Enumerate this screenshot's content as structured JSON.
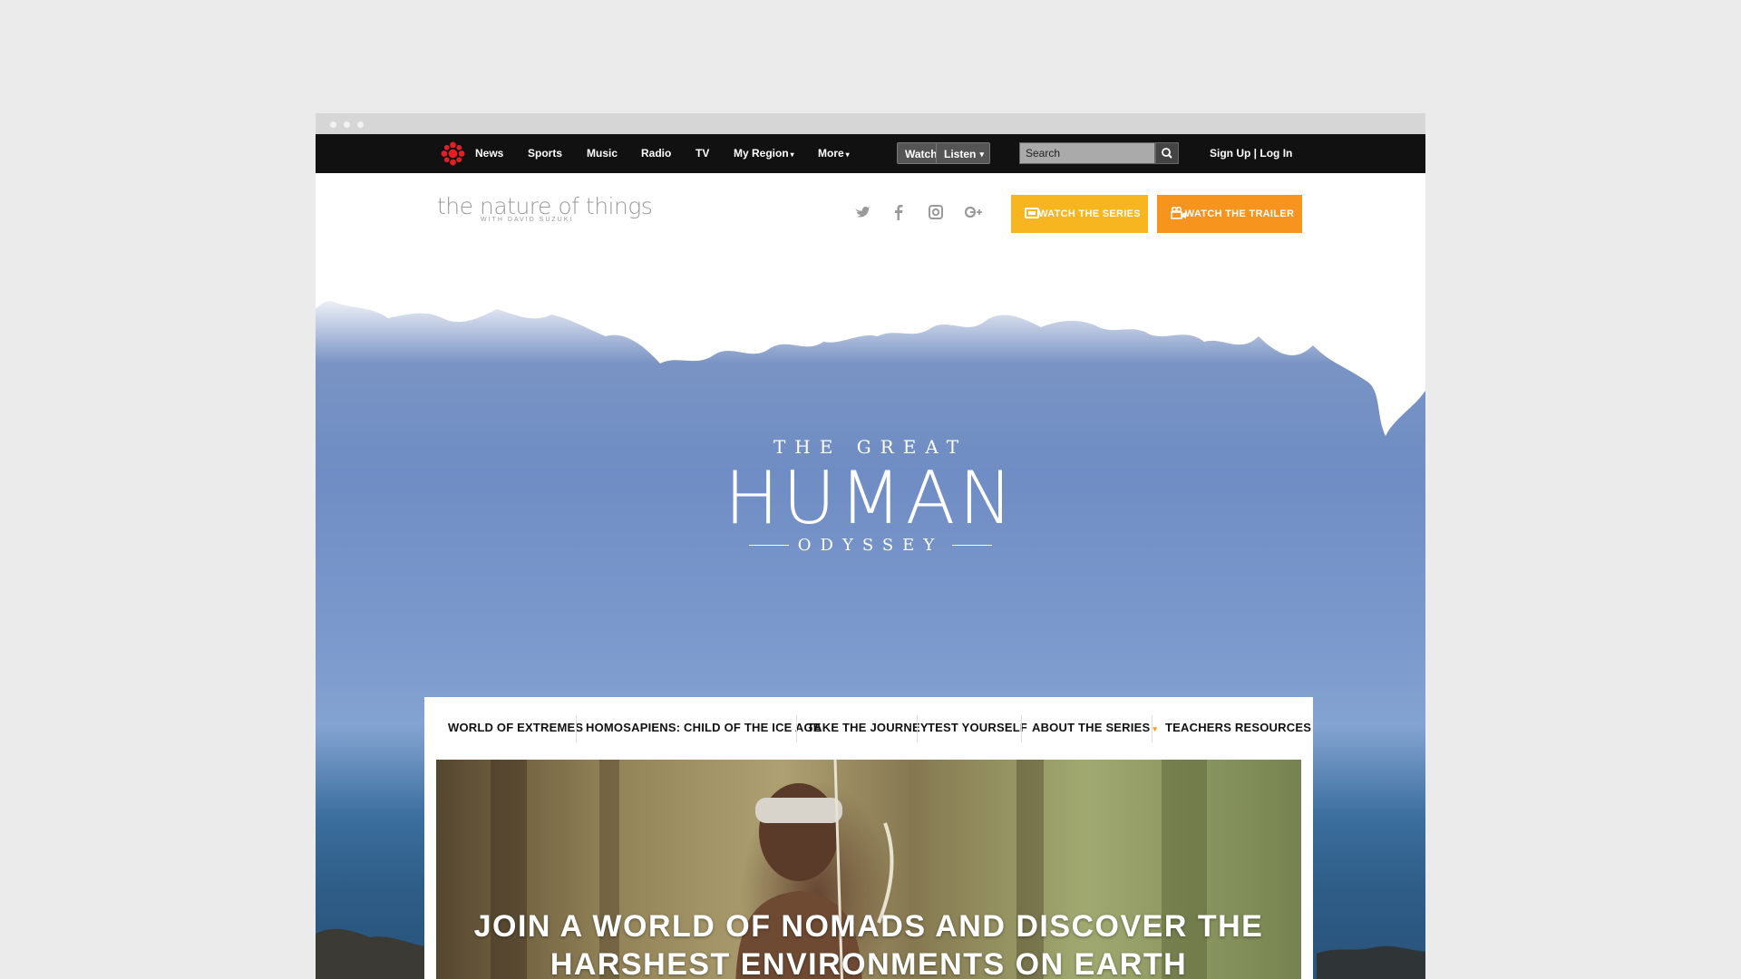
{
  "topnav": {
    "items": [
      "News",
      "Sports",
      "Music",
      "Radio",
      "TV",
      "My Region",
      "More"
    ],
    "watch": "Watch",
    "listen": "Listen",
    "search_placeholder": "Search",
    "signup": "Sign Up",
    "separator": "|",
    "login": "Log In"
  },
  "header": {
    "logo_main": "the nature of things",
    "logo_sub": "WITH DAVID SUZUKI",
    "social_icons": [
      "twitter-icon",
      "facebook-icon",
      "instagram-icon",
      "google-plus-icon"
    ],
    "cta_series": "WATCH THE SERIES",
    "cta_trailer": "WATCH THE TRAILER",
    "colors": {
      "series": "#f7b520",
      "trailer": "#f7941e"
    }
  },
  "hero": {
    "title_top": "THE GREAT",
    "title_main": "HUMAN",
    "title_bottom": "ODYSSEY"
  },
  "subnav": {
    "items": [
      "WORLD OF EXTREMES",
      "HOMOSAPIENS: CHILD OF THE ICE AGE",
      "TAKE THE JOURNEY",
      "TEST YOURSELF",
      "ABOUT THE SERIES",
      "TEACHERS RESOURCES"
    ]
  },
  "feature": {
    "headline_line1": "JOIN A WORLD OF NOMADS AND DISCOVER THE",
    "headline_line2": "HARSHEST ENVIRONMENTS ON EARTH"
  }
}
